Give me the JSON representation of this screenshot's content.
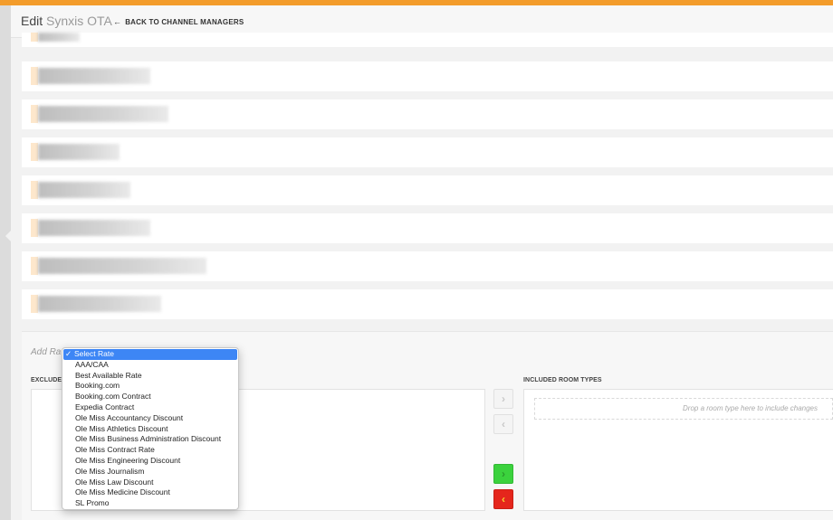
{
  "header": {
    "title_prefix": "Edit",
    "title_name": "Synxis OTA",
    "back_label": "BACK TO CHANNEL MANAGERS",
    "accent_color": "#f39c2b"
  },
  "rate_rows": [
    {
      "label": ""
    },
    {
      "label": ""
    },
    {
      "label": ""
    },
    {
      "label": ""
    },
    {
      "label": ""
    },
    {
      "label": ""
    },
    {
      "label": ""
    },
    {
      "label": ""
    }
  ],
  "add_rate": {
    "label_prefix": "Add Ra",
    "dropdown": {
      "selected_index": 0,
      "options": [
        "Select Rate",
        "AAA/CAA",
        "Best Available Rate",
        "Booking.com",
        "Booking.com Contract",
        "Expedia Contract",
        "Ole Miss Accountancy Discount",
        "Ole Miss Athletics Discount",
        "Ole Miss Business Administration Discount",
        "Ole Miss Contract Rate",
        "Ole Miss Engineering Discount",
        "Ole Miss Journalism",
        "Ole Miss Law Discount",
        "Ole Miss Medicine Discount",
        "SL Promo"
      ]
    }
  },
  "room_types": {
    "excluded_label": "EXCLUDED",
    "included_label": "INCLUDED ROOM TYPES",
    "drop_placeholder": "Drop a room type here to include changes"
  },
  "move_buttons": {
    "right_icon": "chevron-right-icon",
    "left_icon": "chevron-left-icon",
    "add_color": "#3bd23d",
    "remove_color": "#e5261c"
  }
}
